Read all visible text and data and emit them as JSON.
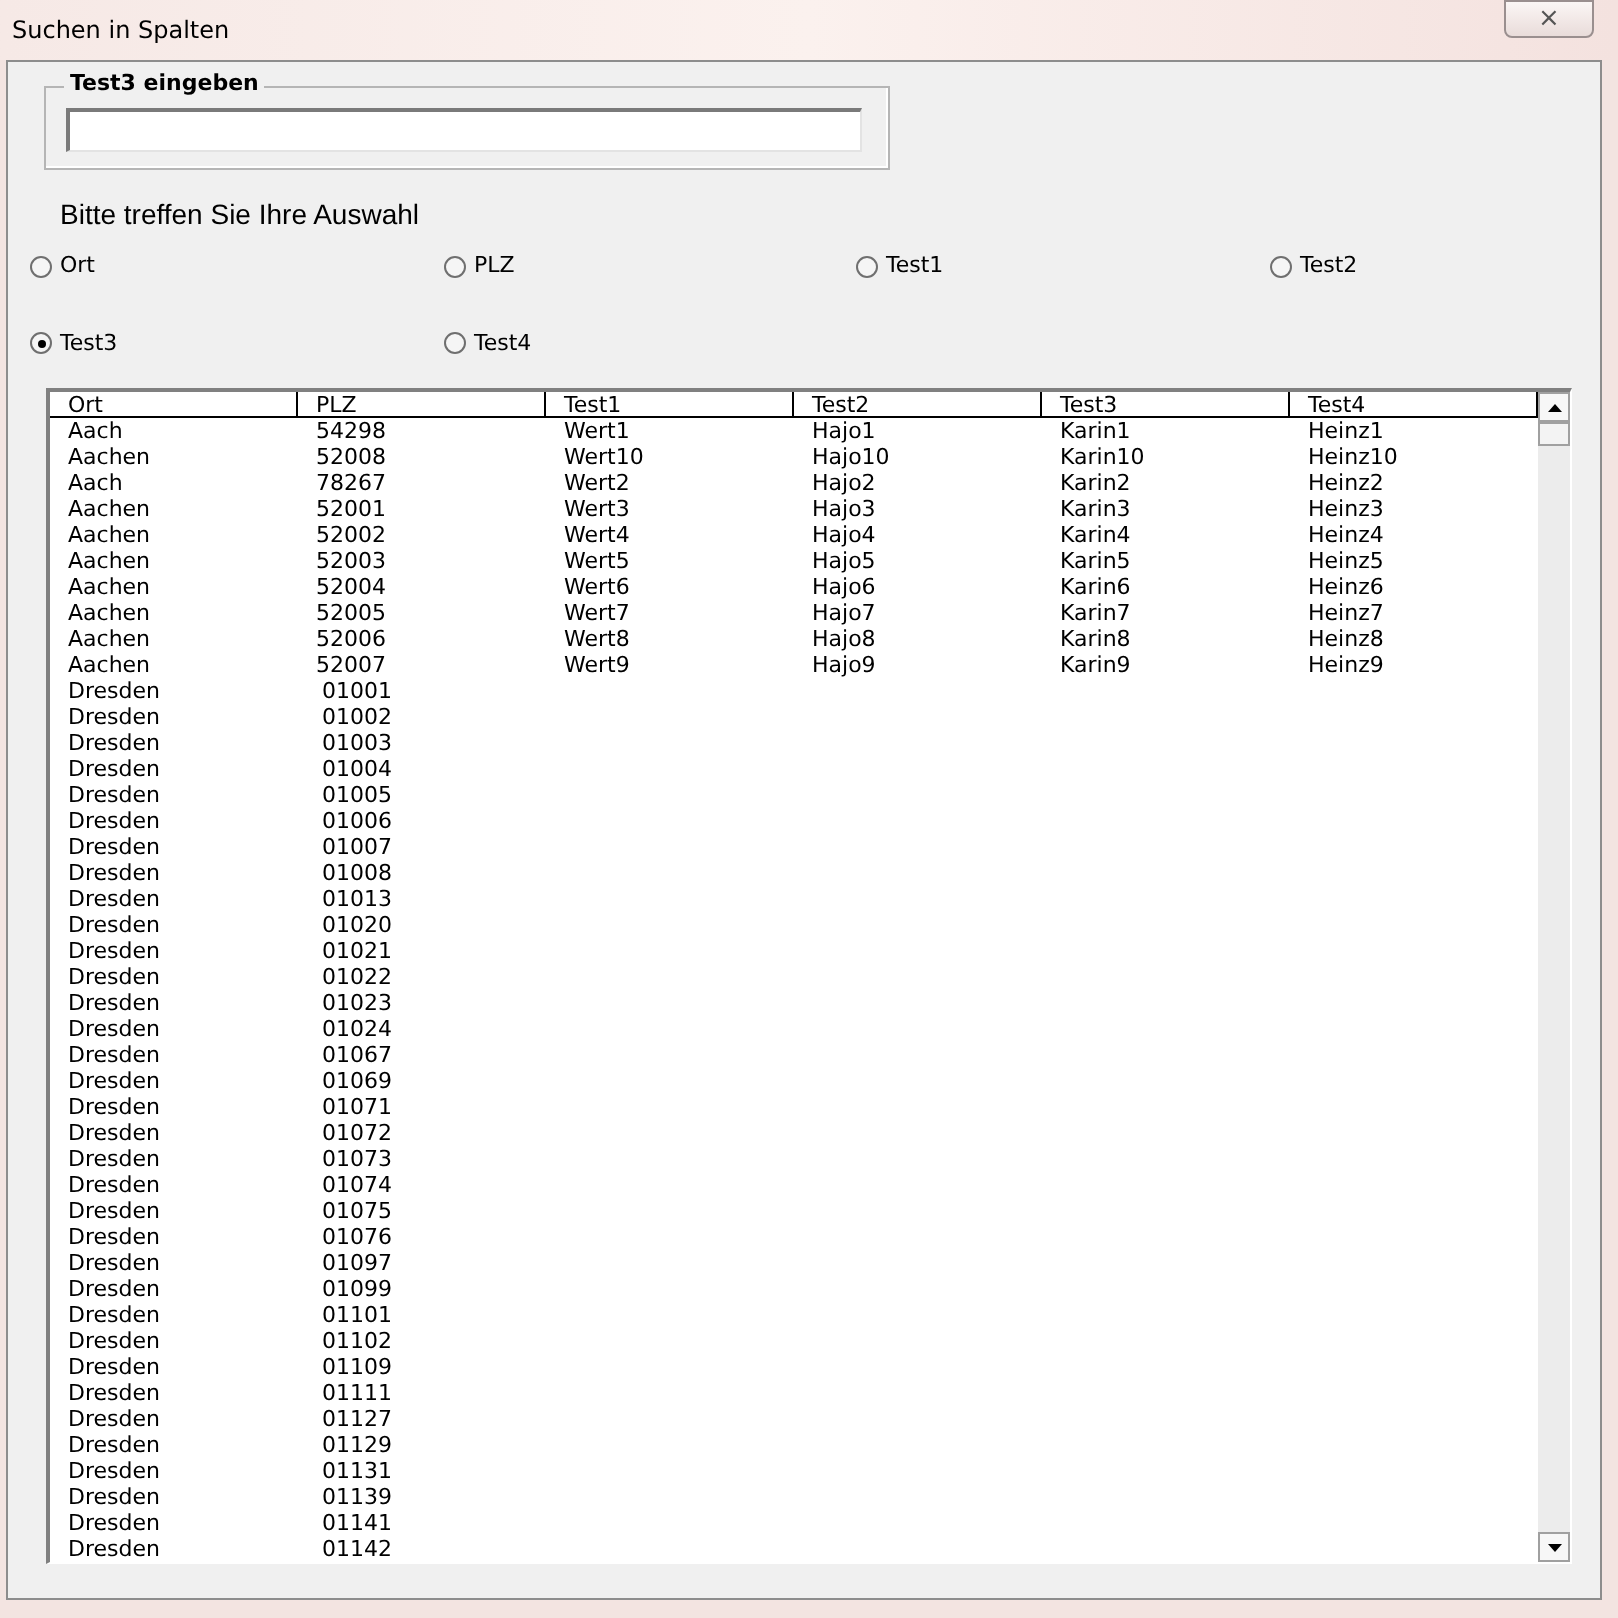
{
  "window": {
    "title": "Suchen in Spalten",
    "close": "⨯"
  },
  "search_group": {
    "label": "Test3 eingeben"
  },
  "prompt": "Bitte treffen Sie Ihre Auswahl",
  "options": [
    {
      "label": "Ort",
      "selected": false
    },
    {
      "label": "PLZ",
      "selected": false
    },
    {
      "label": "Test1",
      "selected": false
    },
    {
      "label": "Test2",
      "selected": false
    },
    {
      "label": "Test3",
      "selected": true
    },
    {
      "label": "Test4",
      "selected": false
    }
  ],
  "table": {
    "columns": [
      "Ort",
      "PLZ",
      "Test1",
      "Test2",
      "Test3",
      "Test4"
    ],
    "rows": [
      [
        "Aach",
        "54298",
        "Wert1",
        "Hajo1",
        "Karin1",
        "Heinz1"
      ],
      [
        "Aachen",
        "52008",
        "Wert10",
        "Hajo10",
        "Karin10",
        "Heinz10"
      ],
      [
        "Aach",
        "78267",
        "Wert2",
        "Hajo2",
        "Karin2",
        "Heinz2"
      ],
      [
        "Aachen",
        "52001",
        "Wert3",
        "Hajo3",
        "Karin3",
        "Heinz3"
      ],
      [
        "Aachen",
        "52002",
        "Wert4",
        "Hajo4",
        "Karin4",
        "Heinz4"
      ],
      [
        "Aachen",
        "52003",
        "Wert5",
        "Hajo5",
        "Karin5",
        "Heinz5"
      ],
      [
        "Aachen",
        "52004",
        "Wert6",
        "Hajo6",
        "Karin6",
        "Heinz6"
      ],
      [
        "Aachen",
        "52005",
        "Wert7",
        "Hajo7",
        "Karin7",
        "Heinz7"
      ],
      [
        "Aachen",
        "52006",
        "Wert8",
        "Hajo8",
        "Karin8",
        "Heinz8"
      ],
      [
        "Aachen",
        "52007",
        "Wert9",
        "Hajo9",
        "Karin9",
        "Heinz9"
      ],
      [
        "Dresden",
        "01001"
      ],
      [
        "Dresden",
        "01002"
      ],
      [
        "Dresden",
        "01003"
      ],
      [
        "Dresden",
        "01004"
      ],
      [
        "Dresden",
        "01005"
      ],
      [
        "Dresden",
        "01006"
      ],
      [
        "Dresden",
        "01007"
      ],
      [
        "Dresden",
        "01008"
      ],
      [
        "Dresden",
        "01013"
      ],
      [
        "Dresden",
        "01020"
      ],
      [
        "Dresden",
        "01021"
      ],
      [
        "Dresden",
        "01022"
      ],
      [
        "Dresden",
        "01023"
      ],
      [
        "Dresden",
        "01024"
      ],
      [
        "Dresden",
        "01067"
      ],
      [
        "Dresden",
        "01069"
      ],
      [
        "Dresden",
        "01071"
      ],
      [
        "Dresden",
        "01072"
      ],
      [
        "Dresden",
        "01073"
      ],
      [
        "Dresden",
        "01074"
      ],
      [
        "Dresden",
        "01075"
      ],
      [
        "Dresden",
        "01076"
      ],
      [
        "Dresden",
        "01097"
      ],
      [
        "Dresden",
        "01099"
      ],
      [
        "Dresden",
        "01101"
      ],
      [
        "Dresden",
        "01102"
      ],
      [
        "Dresden",
        "01109"
      ],
      [
        "Dresden",
        "01111"
      ],
      [
        "Dresden",
        "01127"
      ],
      [
        "Dresden",
        "01129"
      ],
      [
        "Dresden",
        "01131"
      ],
      [
        "Dresden",
        "01139"
      ],
      [
        "Dresden",
        "01141"
      ],
      [
        "Dresden",
        "01142"
      ]
    ]
  }
}
